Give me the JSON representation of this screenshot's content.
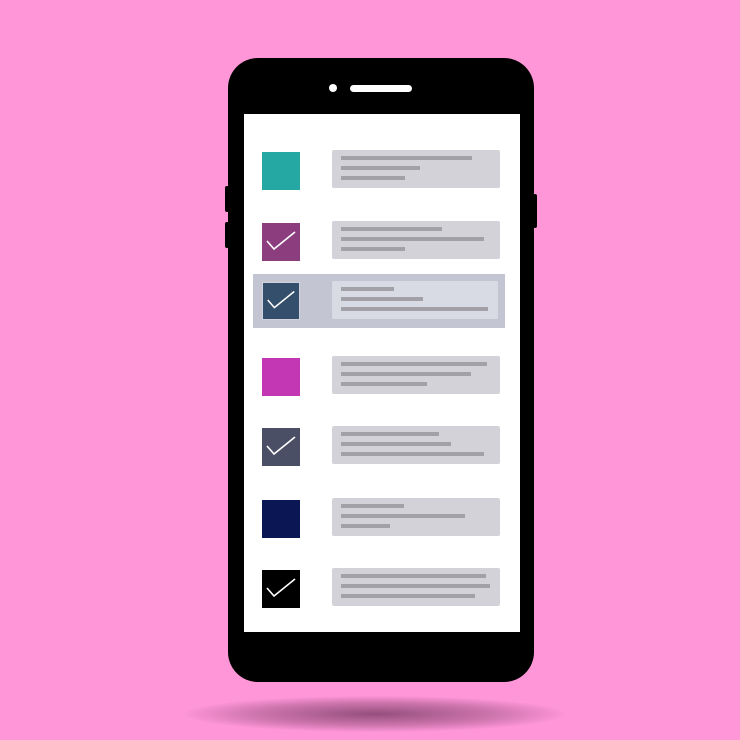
{
  "colors": {
    "background": "#ff96d8",
    "phone_body": "#000000",
    "screen": "#ffffff",
    "card": "#d2d2d8",
    "text_line": "#a1a1a7",
    "selection_highlight": "#c3c5d2",
    "selected_card": "#d8dbe3",
    "speaker": "#ffffff",
    "camera": "#ffffff",
    "shadow": "#3c1432"
  },
  "icons": {
    "checkmark": "check-icon"
  },
  "tasks": [
    {
      "checked": false,
      "selected": false,
      "color": "#25a8a4",
      "lines": [
        0.88,
        0.53,
        0.43
      ]
    },
    {
      "checked": true,
      "selected": false,
      "color": "#8b3d7e",
      "lines": [
        0.68,
        0.96,
        0.43
      ]
    },
    {
      "checked": true,
      "selected": true,
      "color": "#334f6c",
      "lines": [
        0.36,
        0.56,
        1.0
      ]
    },
    {
      "checked": false,
      "selected": false,
      "color": "#c437b4",
      "lines": [
        0.98,
        0.87,
        0.58
      ]
    },
    {
      "checked": true,
      "selected": false,
      "color": "#4a4f66",
      "lines": [
        0.66,
        0.74,
        0.96
      ]
    },
    {
      "checked": false,
      "selected": false,
      "color": "#0b1654",
      "lines": [
        0.42,
        0.83,
        0.33
      ]
    },
    {
      "checked": true,
      "selected": false,
      "color": "#000000",
      "lines": [
        0.97,
        1.0,
        0.9
      ]
    }
  ]
}
